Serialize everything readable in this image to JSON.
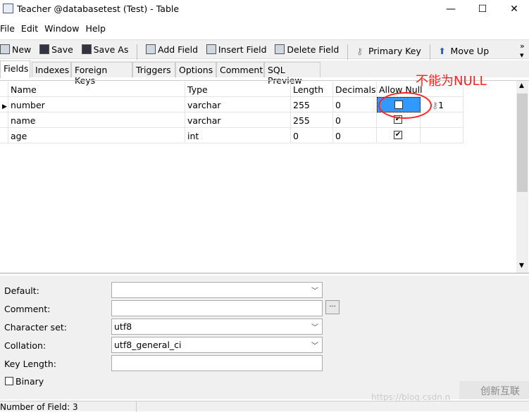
{
  "window": {
    "title": "Teacher @databasetest (Test) - Table",
    "minimize": "—",
    "maximize": "☐",
    "close": "✕"
  },
  "menu": [
    "File",
    "Edit",
    "Window",
    "Help"
  ],
  "toolbar": [
    {
      "label": "New",
      "icon": "new-table-icon"
    },
    {
      "label": "Save",
      "icon": "save-icon"
    },
    {
      "label": "Save As",
      "icon": "save-as-icon"
    },
    {
      "label": "Add Field",
      "icon": "add-field-icon"
    },
    {
      "label": "Insert Field",
      "icon": "insert-field-icon"
    },
    {
      "label": "Delete Field",
      "icon": "delete-field-icon"
    },
    {
      "label": "Primary Key",
      "icon": "key-icon"
    },
    {
      "label": "Move Up",
      "icon": "arrow-up-icon"
    }
  ],
  "tabs": [
    "Fields",
    "Indexes",
    "Foreign Keys",
    "Triggers",
    "Options",
    "Comment",
    "SQL Preview"
  ],
  "grid": {
    "columns": [
      "Name",
      "Type",
      "Length",
      "Decimals",
      "Allow Null",
      ""
    ],
    "rows": [
      {
        "name": "number",
        "type": "varchar",
        "length": "255",
        "decimals": "0",
        "allow_null": false,
        "key": "1"
      },
      {
        "name": "name",
        "type": "varchar",
        "length": "255",
        "decimals": "0",
        "allow_null": true,
        "key": ""
      },
      {
        "name": "age",
        "type": "int",
        "length": "0",
        "decimals": "0",
        "allow_null": true,
        "key": ""
      }
    ]
  },
  "annotation": {
    "text": "不能为NULL",
    "color": "#ff2020"
  },
  "properties": {
    "default_label": "Default:",
    "default_value": "",
    "comment_label": "Comment:",
    "comment_value": "",
    "comment_button": "...",
    "charset_label": "Character set:",
    "charset_value": "utf8",
    "collation_label": "Collation:",
    "collation_value": "utf8_general_ci",
    "keylength_label": "Key Length:",
    "keylength_value": "",
    "binary_label": "Binary",
    "binary_checked": false
  },
  "status": {
    "text": "Number of Field: 3"
  },
  "watermark": {
    "url": "https://blog.csdn.n",
    "logo": "创新互联"
  }
}
